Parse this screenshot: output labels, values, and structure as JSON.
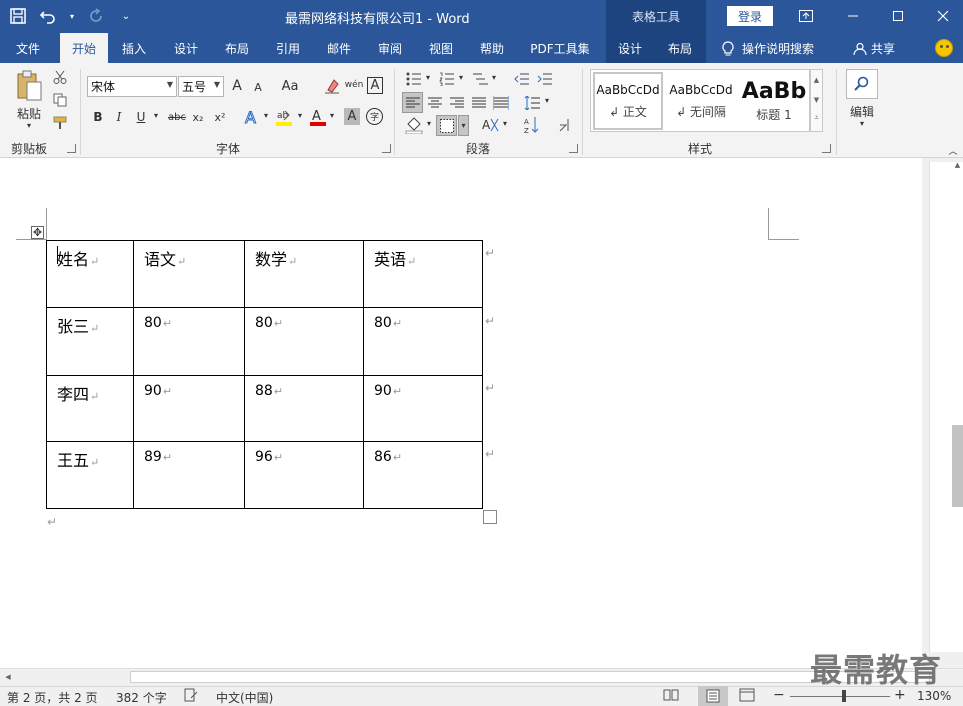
{
  "titlebar": {
    "doc_title": "最需网络科技有限公司1  -  Word",
    "context_group": "表格工具",
    "login": "登录"
  },
  "tabs": {
    "file": "文件",
    "home": "开始",
    "insert": "插入",
    "design": "设计",
    "layout": "布局",
    "references": "引用",
    "mailings": "邮件",
    "review": "审阅",
    "view": "视图",
    "help": "帮助",
    "pdf": "PDF工具集",
    "table_design": "设计",
    "table_layout": "布局",
    "tell_me": "操作说明搜索",
    "share": "共享"
  },
  "ribbon": {
    "clipboard": {
      "label": "剪贴板",
      "paste": "粘贴"
    },
    "font": {
      "label": "字体",
      "font_name": "宋体",
      "font_size": "五号",
      "bold": "B",
      "italic": "I",
      "underline": "U",
      "strike": "abc",
      "sub": "x₂",
      "sup": "x²",
      "grow": "A",
      "shrink": "A",
      "case": "Aa",
      "phonetic": "wén",
      "border_char": "A",
      "shade_char": "A",
      "enclose": "字"
    },
    "paragraph": {
      "label": "段落"
    },
    "styles": {
      "label": "样式",
      "items": [
        {
          "sample": "AaBbCcDd",
          "name": "↲ 正文"
        },
        {
          "sample": "AaBbCcDd",
          "name": "↲ 无间隔"
        },
        {
          "sample": "AaBb",
          "name": "标题 1"
        }
      ]
    },
    "editing": {
      "label": "编辑"
    }
  },
  "table": {
    "rows": [
      [
        "姓名",
        "语文",
        "数学",
        "英语"
      ],
      [
        "张三",
        "80",
        "80",
        "80"
      ],
      [
        "李四",
        "90",
        "88",
        "90"
      ],
      [
        "王五",
        "89",
        "96",
        "86"
      ]
    ],
    "cell_mark": "↵",
    "row_mark": "↵"
  },
  "status": {
    "page": "第 2 页，共 2 页",
    "words": "382 个字",
    "language": "中文(中国)",
    "zoom": "130%",
    "minus": "−",
    "plus": "+"
  },
  "watermark": "最需教育",
  "colors": {
    "title_blue": "#2b579a",
    "context_blue": "#1e4480",
    "ribbon_bg": "#f3f3f3"
  }
}
